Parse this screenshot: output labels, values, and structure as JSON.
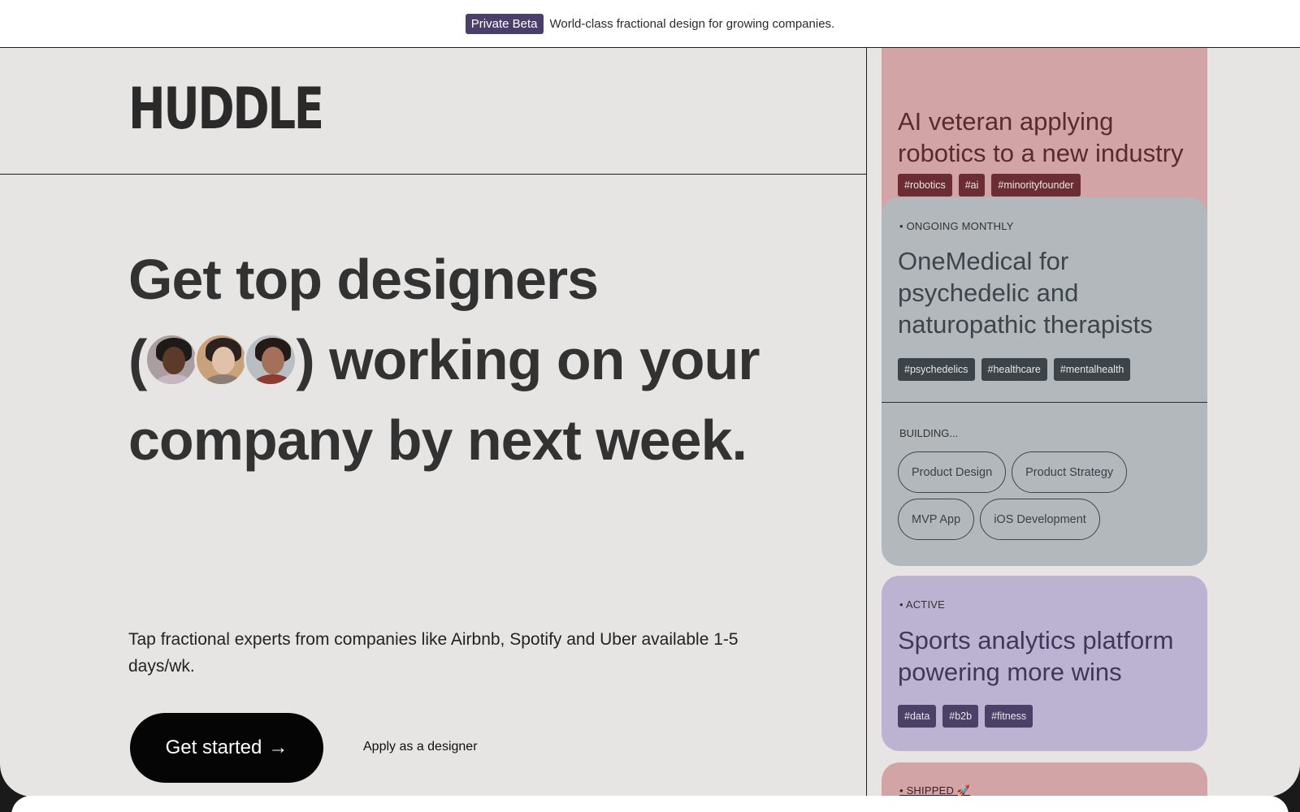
{
  "announcement": {
    "badge": "Private Beta",
    "text": "World-class fractional design for growing companies."
  },
  "brand": {
    "logo": "HUDDLE"
  },
  "hero": {
    "line1": "Get top designers",
    "line2_open": "(",
    "line2_close": ") working on your",
    "line3": "company by next week.",
    "avatars": [
      {
        "icon": "designer-avatar-1"
      },
      {
        "icon": "designer-avatar-2"
      },
      {
        "icon": "designer-avatar-3"
      }
    ],
    "subtitle": "Tap fractional experts from companies like Airbnb, Spotify and Uber available 1-5 days/wk.",
    "cta_label": "Get started",
    "cta_arrow": "→",
    "apply_label": "Apply as a designer"
  },
  "projects": [
    {
      "title": "AI veteran applying robotics to a new industry",
      "tags": [
        "#robotics",
        "#ai",
        "#minorityfounder"
      ],
      "color": "#d3a4a6"
    },
    {
      "status": "• ONGOING MONTHLY",
      "title": "OneMedical for psychedelic and naturopathic therapists",
      "tags": [
        "#psychedelics",
        "#healthcare",
        "#mentalhealth"
      ],
      "building_label": "BUILDING...",
      "building": [
        "Product Design",
        "Product Strategy",
        "MVP App",
        "iOS Development"
      ],
      "color": "#b2b8bc"
    },
    {
      "status": "• ACTIVE",
      "title": "Sports analytics platform powering more wins",
      "tags": [
        "#data",
        "#b2b",
        "#fitness"
      ],
      "color": "#bcb3d3"
    },
    {
      "status": "• SHIPPED 🚀",
      "color": "#d3a4a6"
    }
  ]
}
